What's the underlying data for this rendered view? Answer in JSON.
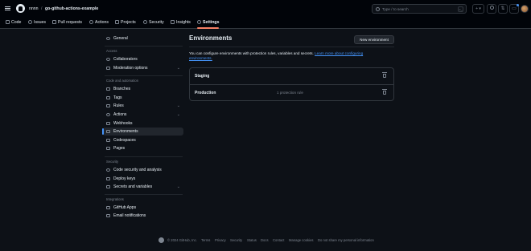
{
  "header": {
    "owner": "nnnn",
    "separator": "/",
    "repo": "go-github-actions-example",
    "search_placeholder": "Type / to search",
    "search_shortcut": ">_",
    "plus_label": "+ ▾"
  },
  "tabs": [
    {
      "label": "Code",
      "icon": "code-icon"
    },
    {
      "label": "Issues",
      "icon": "issue-icon"
    },
    {
      "label": "Pull requests",
      "icon": "pull-request-icon"
    },
    {
      "label": "Actions",
      "icon": "play-icon"
    },
    {
      "label": "Projects",
      "icon": "table-icon"
    },
    {
      "label": "Security",
      "icon": "shield-icon"
    },
    {
      "label": "Insights",
      "icon": "graph-icon"
    },
    {
      "label": "Settings",
      "icon": "gear-icon",
      "active": true
    }
  ],
  "sidebar": {
    "general": "General",
    "access_heading": "Access",
    "collaborators": "Collaborators",
    "moderation": "Moderation options",
    "code_heading": "Code and automation",
    "branches": "Branches",
    "tags": "Tags",
    "rules": "Rules",
    "actions": "Actions",
    "webhooks": "Webhooks",
    "environments": "Environments",
    "codespaces": "Codespaces",
    "pages": "Pages",
    "security_heading": "Security",
    "code_security": "Code security and analysis",
    "deploy_keys": "Deploy keys",
    "secrets": "Secrets and variables",
    "integrations_heading": "Integrations",
    "github_apps": "GitHub Apps",
    "email_notifications": "Email notifications"
  },
  "main": {
    "title": "Environments",
    "new_button": "New environment",
    "description": "You can configure environments with protection rules, variables and secrets.",
    "learn_more": "Learn more about configuring environments.",
    "environments": [
      {
        "name": "Staging",
        "rules": ""
      },
      {
        "name": "Production",
        "rules": "1 protection rule"
      }
    ]
  },
  "footer": {
    "copyright": "© 2024 GitHub, Inc.",
    "links": [
      "Terms",
      "Privacy",
      "Security",
      "Status",
      "Docs",
      "Contact",
      "Manage cookies",
      "Do not share my personal information"
    ]
  },
  "colors": {
    "background": "#0d1117",
    "header_bg": "#010409",
    "border": "#30363d",
    "accent_link": "#4493f8",
    "active_tab_underline": "#f78166"
  }
}
